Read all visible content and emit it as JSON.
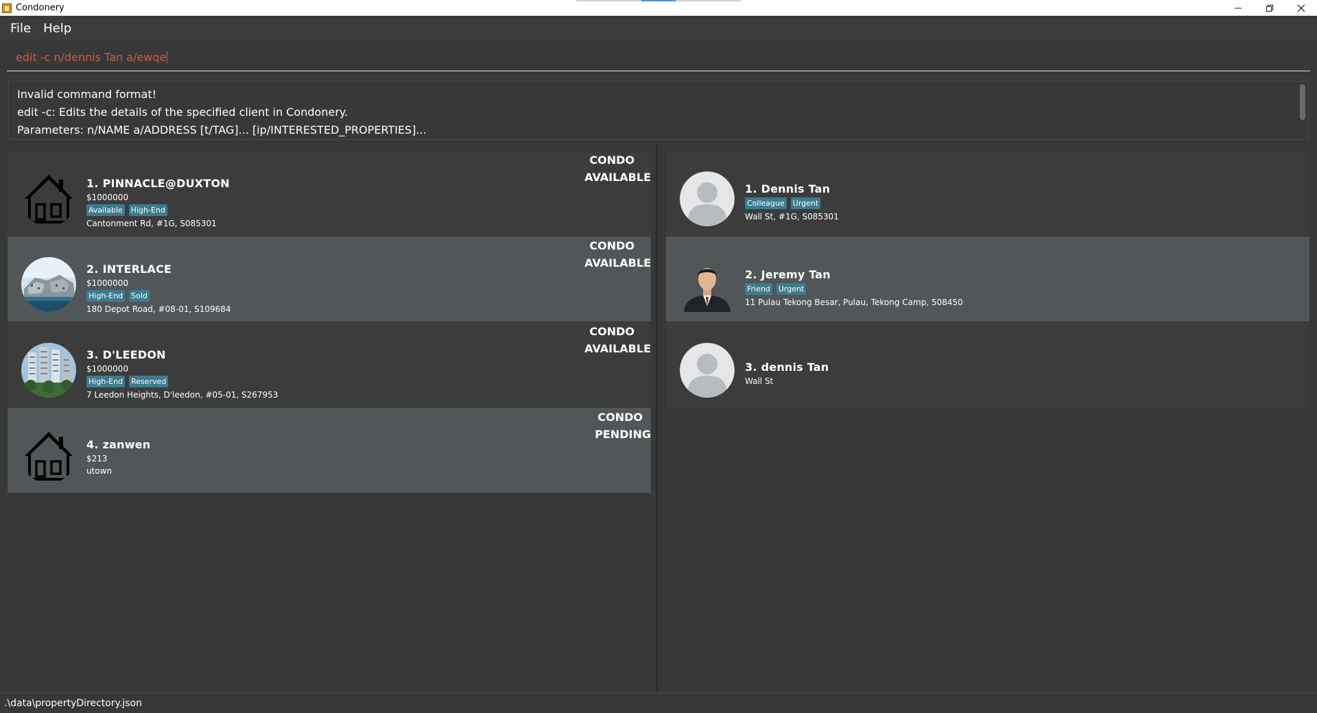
{
  "window": {
    "title": "Condonery"
  },
  "menu": {
    "file": "File",
    "help": "Help"
  },
  "command": {
    "value": "edit -c n/dennis Tan a/ewqe"
  },
  "result": {
    "lines": [
      "Invalid command format!",
      "edit -c: Edits the details of the specified client in Condonery.",
      "Parameters: n/NAME a/ADDRESS [t/TAG]... [ip/INTERESTED_PROPERTIES]..."
    ]
  },
  "properties": [
    {
      "index": "1.",
      "name": "PINNACLE@DUXTON",
      "price": "$1000000",
      "tags": [
        "Available",
        "High-End"
      ],
      "address": "Cantonment Rd, #1G, S085301",
      "type": "CONDO",
      "status": "AVAILABLE",
      "image": "house-icon"
    },
    {
      "index": "2.",
      "name": "INTERLACE",
      "price": "$1000000",
      "tags": [
        "High-End",
        "Sold"
      ],
      "address": "180 Depot Road, #08-01, S109684",
      "type": "CONDO",
      "status": "AVAILABLE",
      "image": "building-photo"
    },
    {
      "index": "3.",
      "name": "D'LEEDON",
      "price": "$1000000",
      "tags": [
        "High-End",
        "Reserved"
      ],
      "address": "7 Leedon Heights, D'leedon, #05-01, S267953",
      "type": "CONDO",
      "status": "AVAILABLE",
      "image": "tower-photo"
    },
    {
      "index": "4.",
      "name": "zanwen",
      "price": "$213",
      "tags": [],
      "address": "utown",
      "type": "CONDO",
      "status": "PENDING",
      "image": "house-icon"
    }
  ],
  "clients": [
    {
      "index": "1.",
      "name": "Dennis Tan",
      "tags": [
        "Colleague",
        "Urgent"
      ],
      "address": "Wall St, #1G, S085301",
      "image": "default-avatar"
    },
    {
      "index": "2.",
      "name": "Jeremy Tan",
      "tags": [
        "Friend",
        "Urgent"
      ],
      "address": "11 Pulau Tekong Besar, Pulau, Tekong Camp, 508450",
      "image": "person-photo"
    },
    {
      "index": "3.",
      "name": "dennis Tan",
      "tags": [],
      "address": "Wall St",
      "image": "default-avatar"
    }
  ],
  "status": {
    "path": ".\\data\\propertyDirectory.json"
  },
  "colors": {
    "tag": "#3e7b91",
    "command_error": "#d05a3a",
    "card_alt": "#515658",
    "background": "#383838"
  }
}
